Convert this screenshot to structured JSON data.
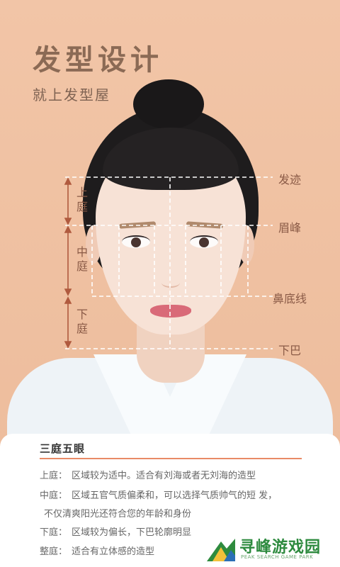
{
  "header": {
    "title": "发型设计",
    "subtitle": "就上发型屋"
  },
  "guides": {
    "right_labels": [
      "发迹",
      "眉峰",
      "鼻底线",
      "下巴"
    ],
    "left_labels": {
      "upper": [
        "上",
        "庭"
      ],
      "middle": [
        "中",
        "庭"
      ],
      "lower": [
        "下",
        "庭"
      ]
    }
  },
  "card": {
    "title": "三庭五眼",
    "rows": [
      {
        "key": "上庭：",
        "text": "区域较为适中。适合有刘海或者无刘海的造型"
      },
      {
        "key": "中庭：",
        "text": "区域五官气质偏柔和，可以选择气质帅气的短  发，"
      },
      {
        "key": "",
        "text": "不仅清爽阳光还符合您的年龄和身份"
      },
      {
        "key": "下庭：",
        "text": "区域较为偏长，下巴轮廓明显"
      },
      {
        "key": "整庭：",
        "text": "适合有立体感的造型"
      }
    ]
  },
  "watermark": {
    "name": "寻峰游戏园",
    "sub": "PEAK SEARCH GAME PARK"
  },
  "colors": {
    "background": "#f1c3a4",
    "accent": "#e88a67",
    "guide_line": "#ffffff",
    "label": "#8a5a46"
  }
}
